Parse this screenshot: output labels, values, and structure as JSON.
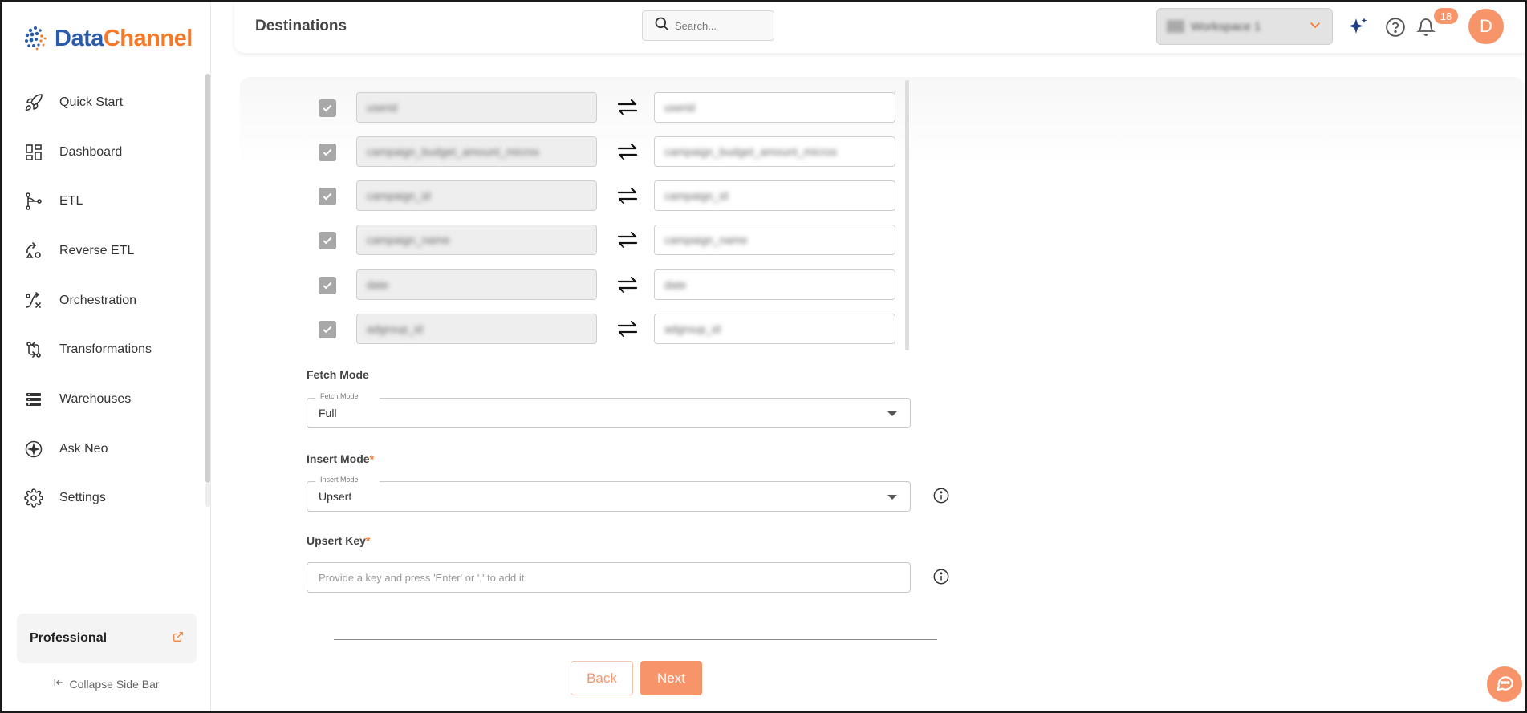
{
  "app": {
    "logo_first": "Data",
    "logo_second": "Channel"
  },
  "sidebar": {
    "items": [
      {
        "label": "Quick Start",
        "icon": "rocket-icon"
      },
      {
        "label": "Dashboard",
        "icon": "dashboard-icon"
      },
      {
        "label": "ETL",
        "icon": "etl-icon"
      },
      {
        "label": "Reverse ETL",
        "icon": "reverse-etl-icon"
      },
      {
        "label": "Orchestration",
        "icon": "orchestration-icon"
      },
      {
        "label": "Transformations",
        "icon": "transformations-icon"
      },
      {
        "label": "Warehouses",
        "icon": "warehouses-icon"
      },
      {
        "label": "Ask Neo",
        "icon": "ask-neo-icon"
      },
      {
        "label": "Settings",
        "icon": "gear-icon"
      }
    ],
    "plan_label": "Professional",
    "collapse_label": "Collapse Side Bar"
  },
  "header": {
    "title": "Destinations",
    "search_placeholder": "Search...",
    "workspace_name": "Workspace 1",
    "notification_count": "18",
    "avatar_initial": "D"
  },
  "mapping": {
    "rows": [
      {
        "source": "userid",
        "destination": "userid"
      },
      {
        "source": "campaign_budget_amount_micros",
        "destination": "campaign_budget_amount_micros"
      },
      {
        "source": "campaign_id",
        "destination": "campaign_id"
      },
      {
        "source": "campaign_name",
        "destination": "campaign_name"
      },
      {
        "source": "date",
        "destination": "date"
      },
      {
        "source": "adgroup_id",
        "destination": "adgroup_id"
      }
    ]
  },
  "form": {
    "fetch_mode": {
      "label": "Fetch Mode",
      "legend": "Fetch Mode",
      "value": "Full"
    },
    "insert_mode": {
      "label": "Insert Mode",
      "required_mark": "*",
      "legend": "Insert Mode",
      "value": "Upsert"
    },
    "upsert_key": {
      "label": "Upsert Key",
      "required_mark": "*",
      "placeholder": "Provide a key and press 'Enter' or ',' to add it."
    }
  },
  "actions": {
    "back_label": "Back",
    "next_label": "Next"
  },
  "colors": {
    "accent": "#f7946a",
    "brand_blue": "#2a5caa",
    "brand_orange": "#f47a2a"
  }
}
